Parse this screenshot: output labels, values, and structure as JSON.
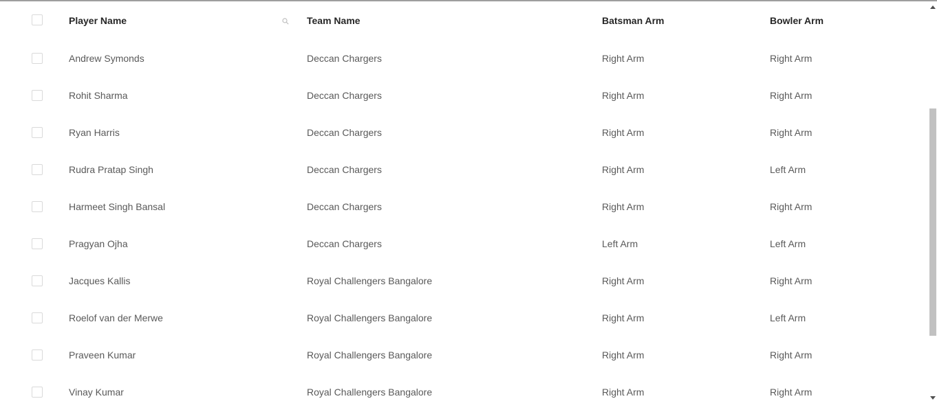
{
  "table": {
    "columns": {
      "player_name": "Player Name",
      "team_name": "Team Name",
      "batsman_arm": "Batsman Arm",
      "bowler_arm": "Bowler Arm"
    },
    "rows": [
      {
        "player": "Andrew Symonds",
        "team": "Deccan Chargers",
        "bat": "Right Arm",
        "bowl": "Right Arm"
      },
      {
        "player": "Rohit Sharma",
        "team": "Deccan Chargers",
        "bat": "Right Arm",
        "bowl": "Right Arm"
      },
      {
        "player": "Ryan Harris",
        "team": "Deccan Chargers",
        "bat": "Right Arm",
        "bowl": "Right Arm"
      },
      {
        "player": "Rudra Pratap Singh",
        "team": "Deccan Chargers",
        "bat": "Right Arm",
        "bowl": "Left Arm"
      },
      {
        "player": "Harmeet Singh Bansal",
        "team": "Deccan Chargers",
        "bat": "Right Arm",
        "bowl": "Right Arm"
      },
      {
        "player": "Pragyan Ojha",
        "team": "Deccan Chargers",
        "bat": "Left Arm",
        "bowl": "Left Arm"
      },
      {
        "player": "Jacques Kallis",
        "team": "Royal Challengers Bangalore",
        "bat": "Right Arm",
        "bowl": "Right Arm"
      },
      {
        "player": "Roelof van der Merwe",
        "team": "Royal Challengers Bangalore",
        "bat": "Right Arm",
        "bowl": "Left Arm"
      },
      {
        "player": "Praveen Kumar",
        "team": "Royal Challengers Bangalore",
        "bat": "Right Arm",
        "bowl": "Right Arm"
      },
      {
        "player": "Vinay Kumar",
        "team": "Royal Challengers Bangalore",
        "bat": "Right Arm",
        "bowl": "Right Arm"
      }
    ]
  },
  "icons": {
    "column_search": "search-icon"
  },
  "colors": {
    "header_text": "#262626",
    "cell_text": "#595959",
    "checkbox_border": "#d9d9d9",
    "scroll_thumb": "#c1c1c1"
  }
}
